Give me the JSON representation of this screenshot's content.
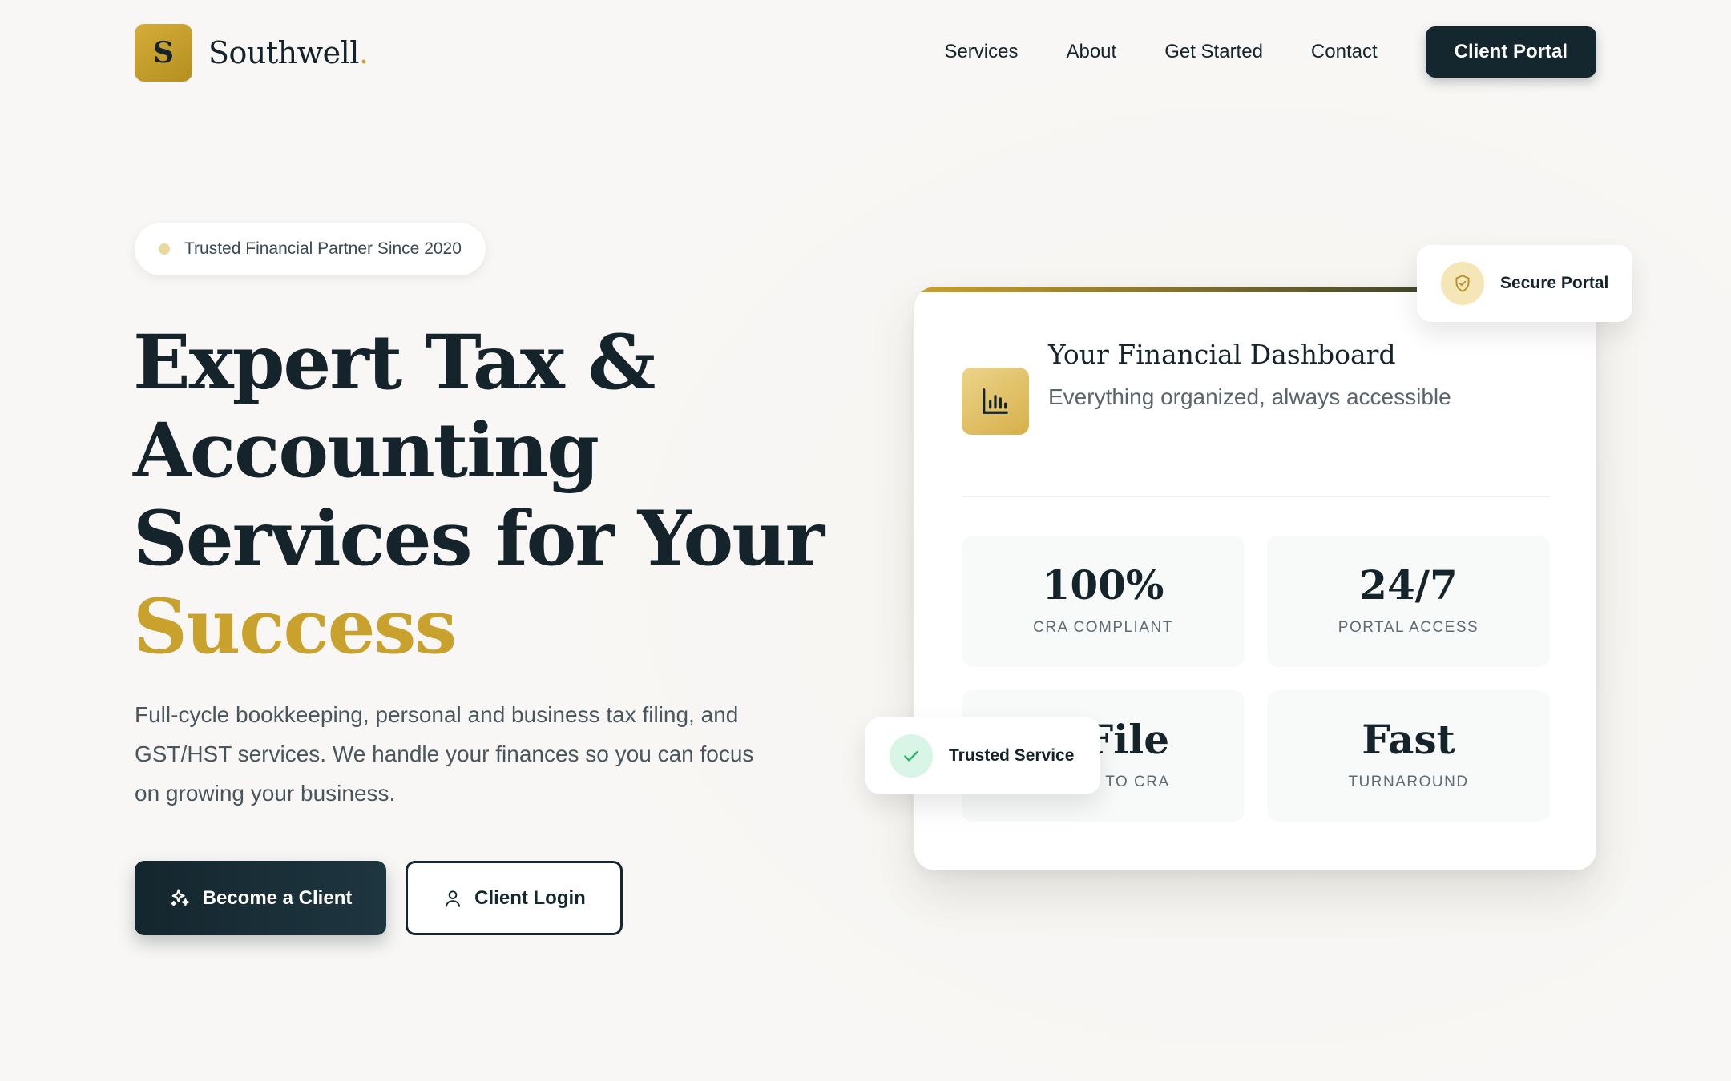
{
  "colors": {
    "brand_dark": "#14262e",
    "brand_gold": "#c9a22e",
    "success_green": "#2bb36a"
  },
  "nav": {
    "logo_letter": "S",
    "logo_name": "Southwell",
    "logo_dot": ".",
    "links": [
      "Services",
      "About",
      "Get Started",
      "Contact"
    ],
    "cta_label": "Client Portal"
  },
  "hero": {
    "badge": "Trusted Financial Partner Since 2020",
    "headline_lines": [
      "Expert Tax &",
      "Accounting",
      "Services for Your"
    ],
    "headline_highlight": "Success",
    "lead": "Full-cycle bookkeeping, personal and business tax filing, and GST/HST services. We handle your finances so you can focus on growing your business.",
    "primary_button": {
      "label": "Become a Client",
      "icon": "sparkles-icon"
    },
    "secondary_button": {
      "label": "Client Login",
      "icon": "user-icon"
    }
  },
  "dashboard": {
    "icon": "bar-chart-icon",
    "title": "Your Financial Dashboard",
    "subtitle": "Everything organized, always accessible",
    "stats": [
      {
        "value": "100%",
        "label": "CRA COMPLIANT"
      },
      {
        "value": "24/7",
        "label": "PORTAL ACCESS"
      },
      {
        "value": "E-File",
        "label": "DIRECT TO CRA"
      },
      {
        "value": "Fast",
        "label": "TURNAROUND"
      }
    ]
  },
  "badges": {
    "secure": {
      "label": "Secure Portal",
      "icon": "shield-check-icon"
    },
    "trusted": {
      "label": "Trusted Service",
      "icon": "check-icon"
    }
  }
}
